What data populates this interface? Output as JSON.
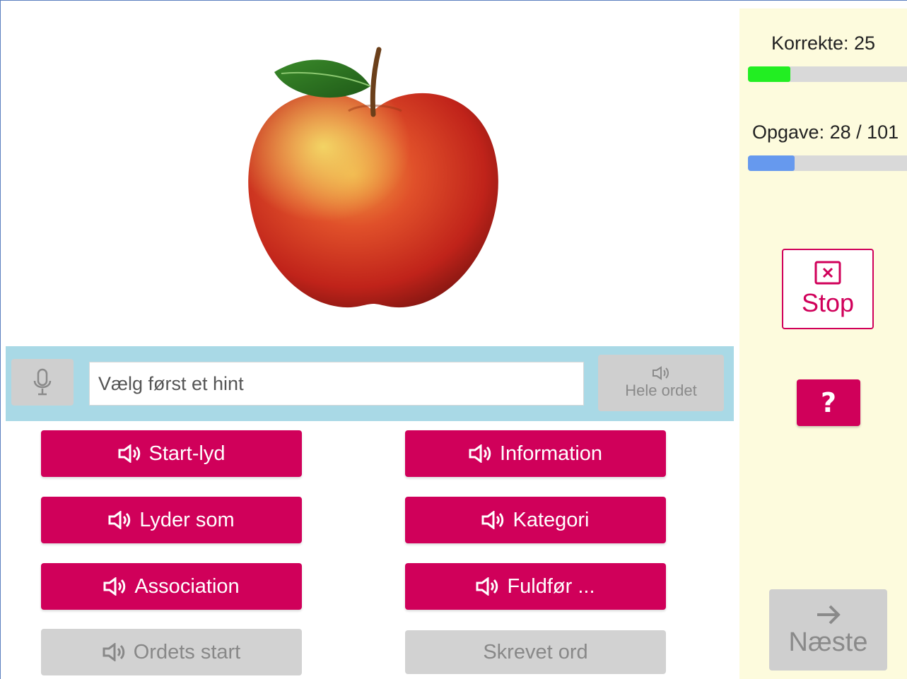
{
  "hint_bar": {
    "input_placeholder": "Vælg først et hint",
    "whole_word_label": "Hele ordet"
  },
  "hints": {
    "start_sound": "Start-lyd",
    "information": "Information",
    "sounds_like": "Lyder som",
    "category": "Kategori",
    "association": "Association",
    "complete": "Fuldfør ...",
    "word_start": "Ordets start",
    "written_word": "Skrevet ord"
  },
  "stats": {
    "correct_label": "Korrekte: 25",
    "correct_progress": 0.25,
    "task_label": "Opgave: 28 / 101",
    "task_progress": 0.277
  },
  "actions": {
    "stop_label": "Stop",
    "help_label": "?",
    "next_label": "Næste"
  },
  "icons": {
    "mic": "microphone-icon",
    "speaker": "speaker-icon",
    "stop": "close-box-icon",
    "next": "arrow-right-icon"
  },
  "colors": {
    "accent": "#d0005a",
    "hint_bar": "#a9d9e6",
    "sidebar": "#fdfbdd",
    "correct_bar": "#22ee22",
    "task_bar": "#6699ee",
    "disabled": "#cfcfcf"
  }
}
